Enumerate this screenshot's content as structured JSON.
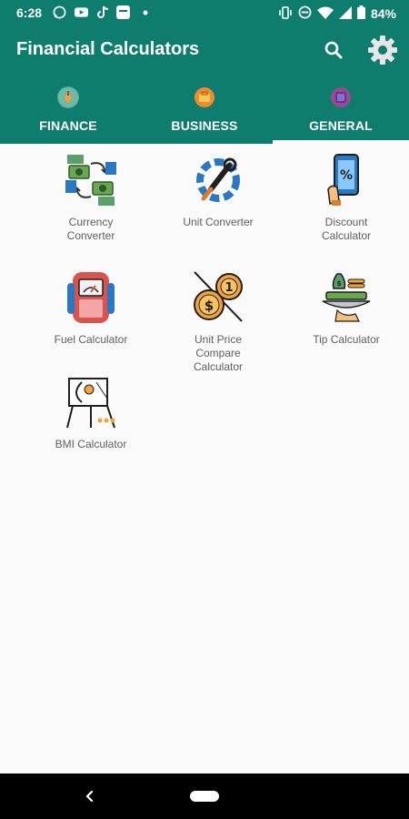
{
  "status_bar": {
    "time": "6:28",
    "battery": "84%",
    "left_icons": [
      "whatsapp-icon",
      "youtube-icon",
      "tiktok-icon",
      "app-icon",
      "dot-icon"
    ],
    "right_icons": [
      "vibrate-icon",
      "dnd-icon",
      "wifi-icon",
      "signal-icon",
      "battery-icon"
    ]
  },
  "app_bar": {
    "title": "Financial Calculators",
    "background": "#0e7d6e"
  },
  "tabs": [
    {
      "label": "FINANCE",
      "icon": "finance-tab-icon"
    },
    {
      "label": "BUSINESS",
      "icon": "business-tab-icon"
    },
    {
      "label": "GENERAL",
      "icon": "general-tab-icon",
      "selected": true
    }
  ],
  "calculators": [
    {
      "label": "Currency\nConverter",
      "icon": "currency-exchange-icon"
    },
    {
      "label": "Unit Converter",
      "icon": "gear-wrench-icon"
    },
    {
      "label": "Discount\nCalculator",
      "icon": "phone-discount-icon"
    },
    {
      "label": "Fuel Calculator",
      "icon": "fuel-pump-icon"
    },
    {
      "label": "Unit Price\nCompare\nCalculator",
      "icon": "coins-compare-icon"
    },
    {
      "label": "Tip Calculator",
      "icon": "tip-tray-icon"
    },
    {
      "label": "BMI Calculator",
      "icon": "presentation-chart-icon"
    }
  ],
  "nav_bar": {
    "buttons": [
      "back-button",
      "home-button"
    ]
  }
}
